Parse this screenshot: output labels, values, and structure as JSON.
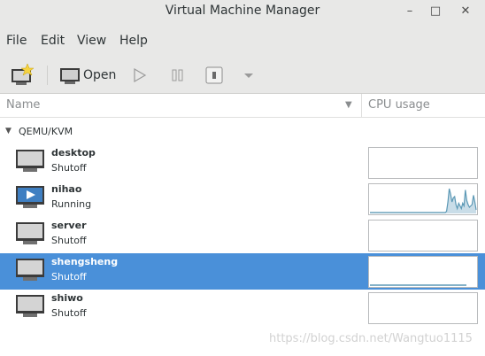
{
  "window": {
    "title": "Virtual Machine Manager"
  },
  "menubar": {
    "items": [
      "File",
      "Edit",
      "View",
      "Help"
    ]
  },
  "toolbar": {
    "open_label": "Open"
  },
  "columns": {
    "name": "Name",
    "cpu": "CPU usage"
  },
  "group": {
    "name": "QEMU/KVM"
  },
  "vms": [
    {
      "name": "desktop",
      "status": "Shutoff",
      "running": false,
      "selected": false,
      "cpu": []
    },
    {
      "name": "nihao",
      "status": "Running",
      "running": true,
      "selected": false,
      "cpu": [
        0,
        0,
        0,
        0,
        0,
        0,
        0,
        0,
        0,
        0,
        0,
        0,
        0,
        0,
        0,
        0,
        0,
        0,
        0,
        0,
        0,
        0,
        0,
        0,
        0,
        0,
        0,
        0,
        0,
        0,
        0,
        0,
        0,
        0,
        0,
        0,
        0,
        0,
        0,
        0,
        0,
        0,
        0,
        0,
        0,
        0,
        0,
        0,
        0,
        0,
        0,
        0,
        0,
        0,
        0,
        0,
        0,
        5,
        40,
        90,
        70,
        40,
        55,
        60,
        30,
        15,
        35,
        25,
        15,
        35,
        25,
        85,
        45,
        30,
        20,
        25,
        30,
        65,
        40,
        10
      ]
    },
    {
      "name": "server",
      "status": "Shutoff",
      "running": false,
      "selected": false,
      "cpu": []
    },
    {
      "name": "shengsheng",
      "status": "Shutoff",
      "running": false,
      "selected": true,
      "cpu": []
    },
    {
      "name": "shiwo",
      "status": "Shutoff",
      "running": false,
      "selected": false,
      "cpu": []
    }
  ],
  "watermark": "https://blog.csdn.net/Wangtuo1115",
  "colors": {
    "selection": "#4a90d9",
    "chart_line": "#5b98b5",
    "chart_fill": "#c9dde8"
  }
}
